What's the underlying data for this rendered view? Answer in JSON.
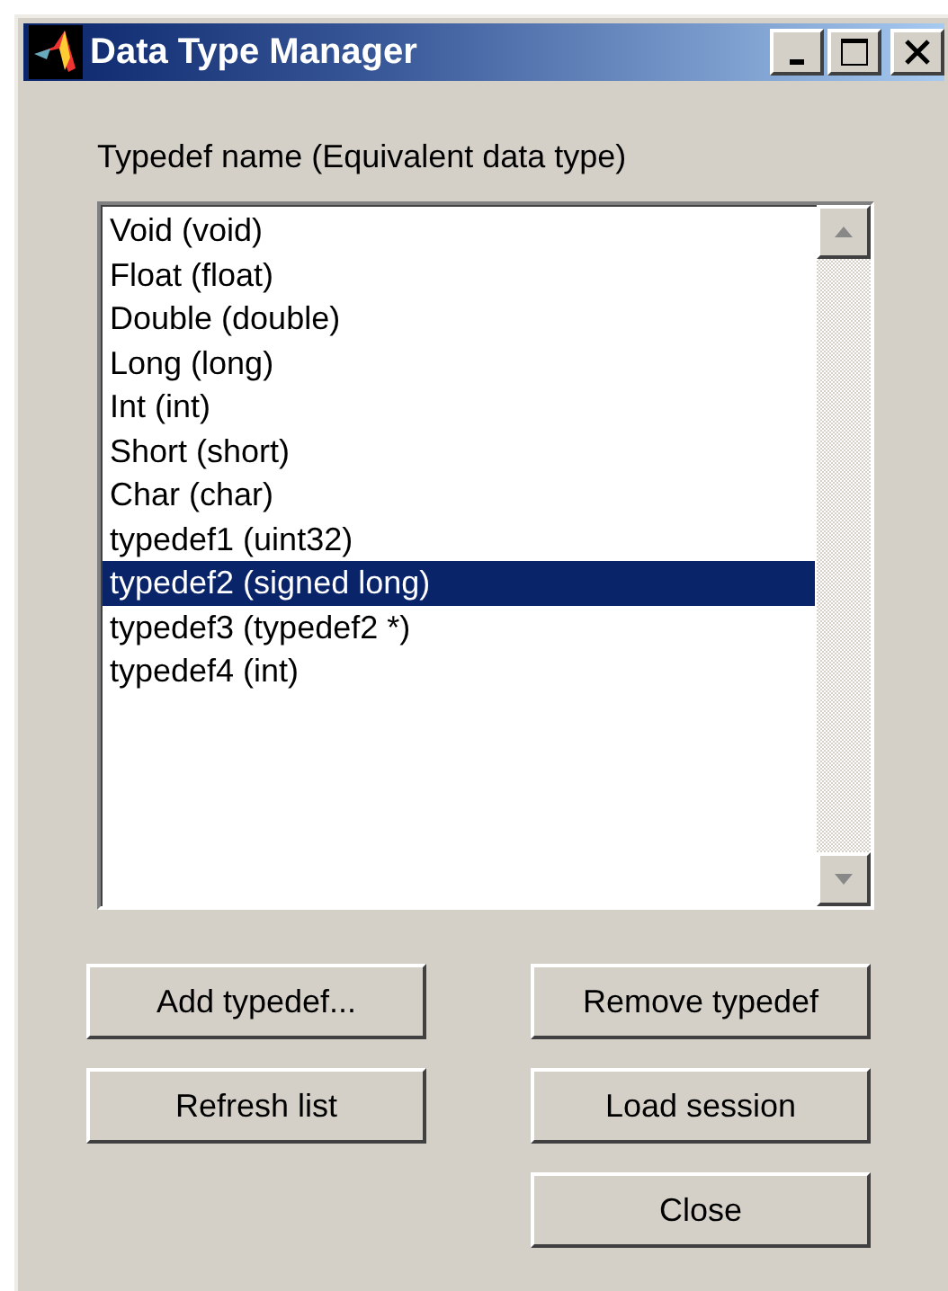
{
  "window": {
    "title": "Data Type Manager"
  },
  "list_label": "Typedef name (Equivalent data type)",
  "items": [
    {
      "label": "Void (void)",
      "selected": false
    },
    {
      "label": "Float (float)",
      "selected": false
    },
    {
      "label": "Double (double)",
      "selected": false
    },
    {
      "label": "Long (long)",
      "selected": false
    },
    {
      "label": "Int (int)",
      "selected": false
    },
    {
      "label": "Short (short)",
      "selected": false
    },
    {
      "label": "Char (char)",
      "selected": false
    },
    {
      "label": "typedef1 (uint32)",
      "selected": false
    },
    {
      "label": "typedef2 (signed long)",
      "selected": true
    },
    {
      "label": "typedef3 (typedef2 *)",
      "selected": false
    },
    {
      "label": "typedef4 (int)",
      "selected": false
    }
  ],
  "buttons": [
    {
      "label": "Add typedef..."
    },
    {
      "label": "Remove typedef"
    },
    {
      "label": "Refresh list"
    },
    {
      "label": "Load session"
    },
    {
      "label": "Close"
    }
  ]
}
